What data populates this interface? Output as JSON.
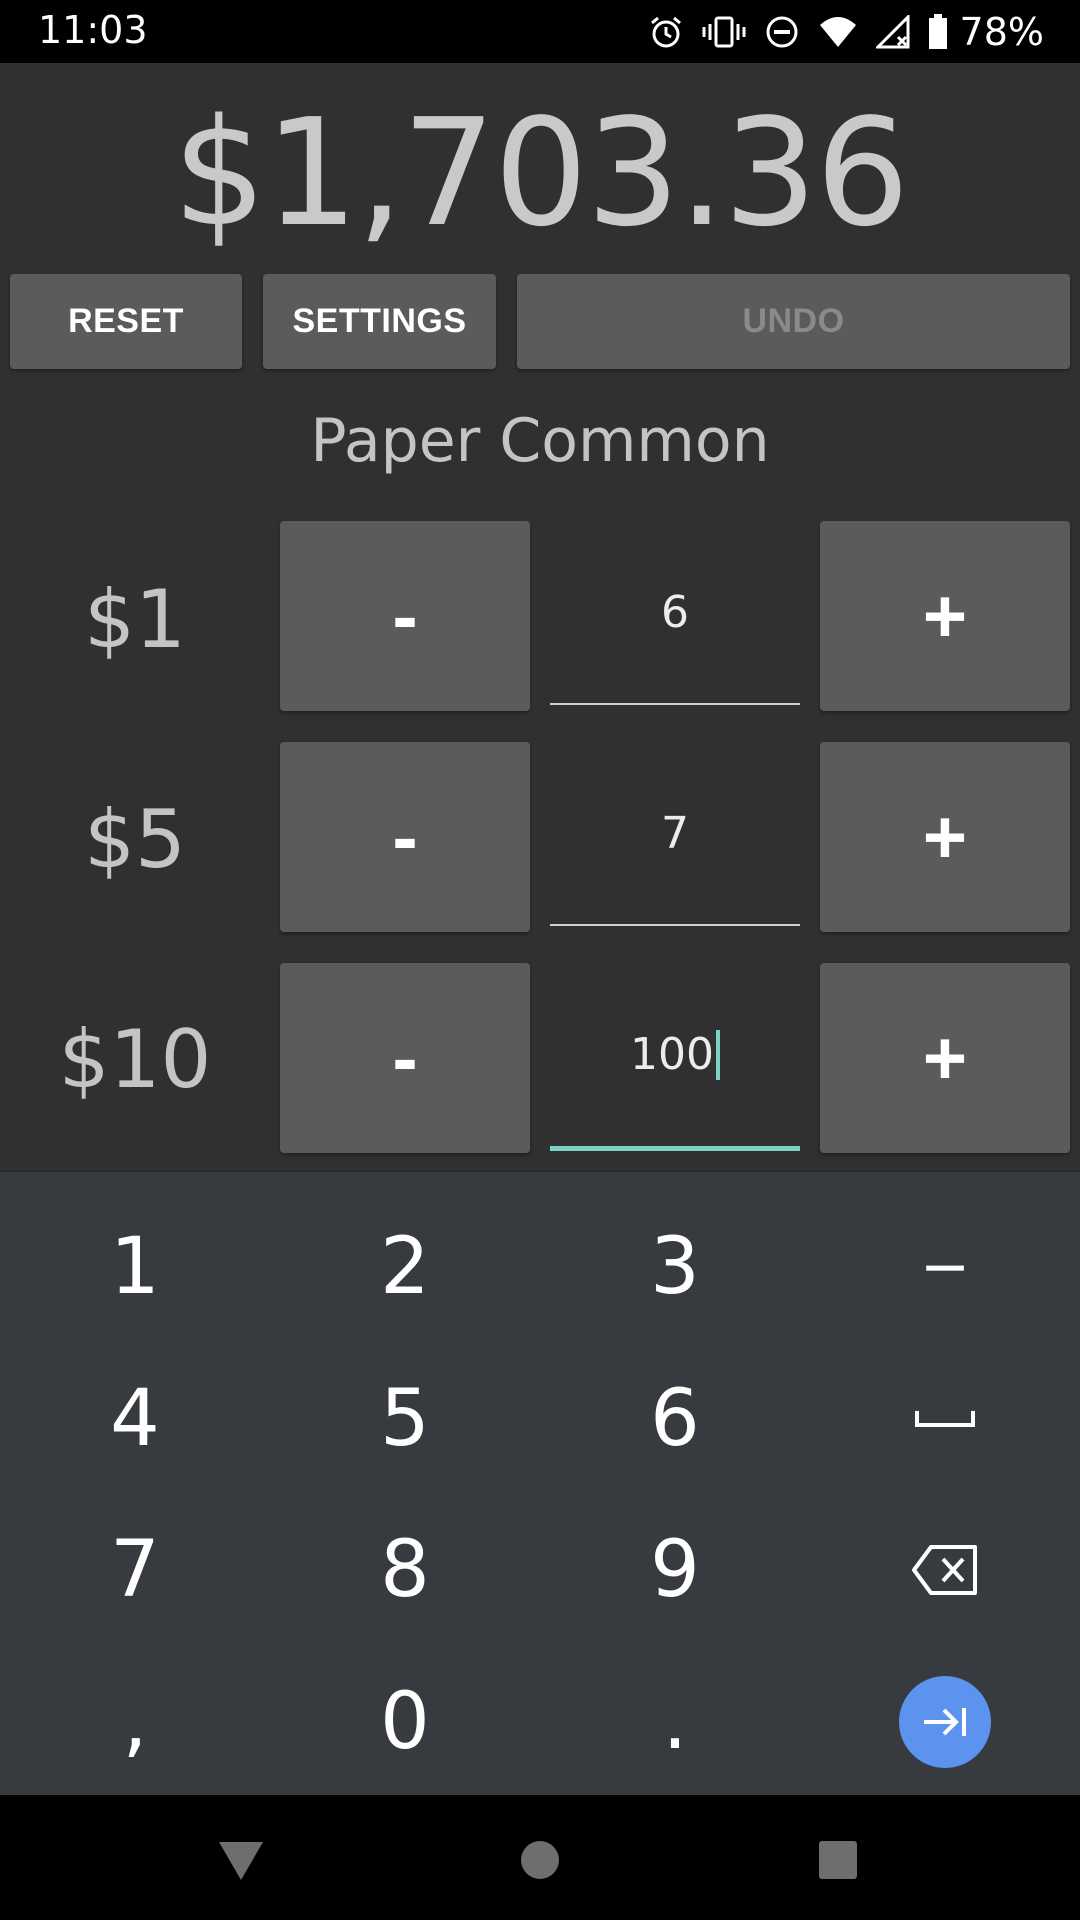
{
  "status_bar": {
    "time": "11:03",
    "battery_percent": "78%",
    "icons": [
      "alarm-icon",
      "vibrate-icon",
      "do-not-disturb-icon",
      "wifi-icon",
      "cell-signal-icon",
      "battery-icon"
    ]
  },
  "total": "$1,703.36",
  "actions": {
    "reset": "RESET",
    "settings": "SETTINGS",
    "undo": "UNDO"
  },
  "section_title": "Paper Common",
  "rows": [
    {
      "denomination": "$1",
      "minus": "-",
      "quantity": "6",
      "plus": "+"
    },
    {
      "denomination": "$5",
      "minus": "-",
      "quantity": "7",
      "plus": "+"
    },
    {
      "denomination": "$10",
      "minus": "-",
      "quantity": "100",
      "plus": "+"
    }
  ],
  "keyboard": {
    "keys": [
      "1",
      "2",
      "3",
      "−",
      "4",
      "5",
      "6",
      "space",
      "7",
      "8",
      "9",
      "backspace",
      ",",
      "0",
      ".",
      "next"
    ]
  },
  "colors": {
    "app_background": "#303030",
    "button": "#5b5b5c",
    "accent": "#7fd0c6",
    "keyboard_background": "#373b3f",
    "go_key": "#5b93ee"
  }
}
